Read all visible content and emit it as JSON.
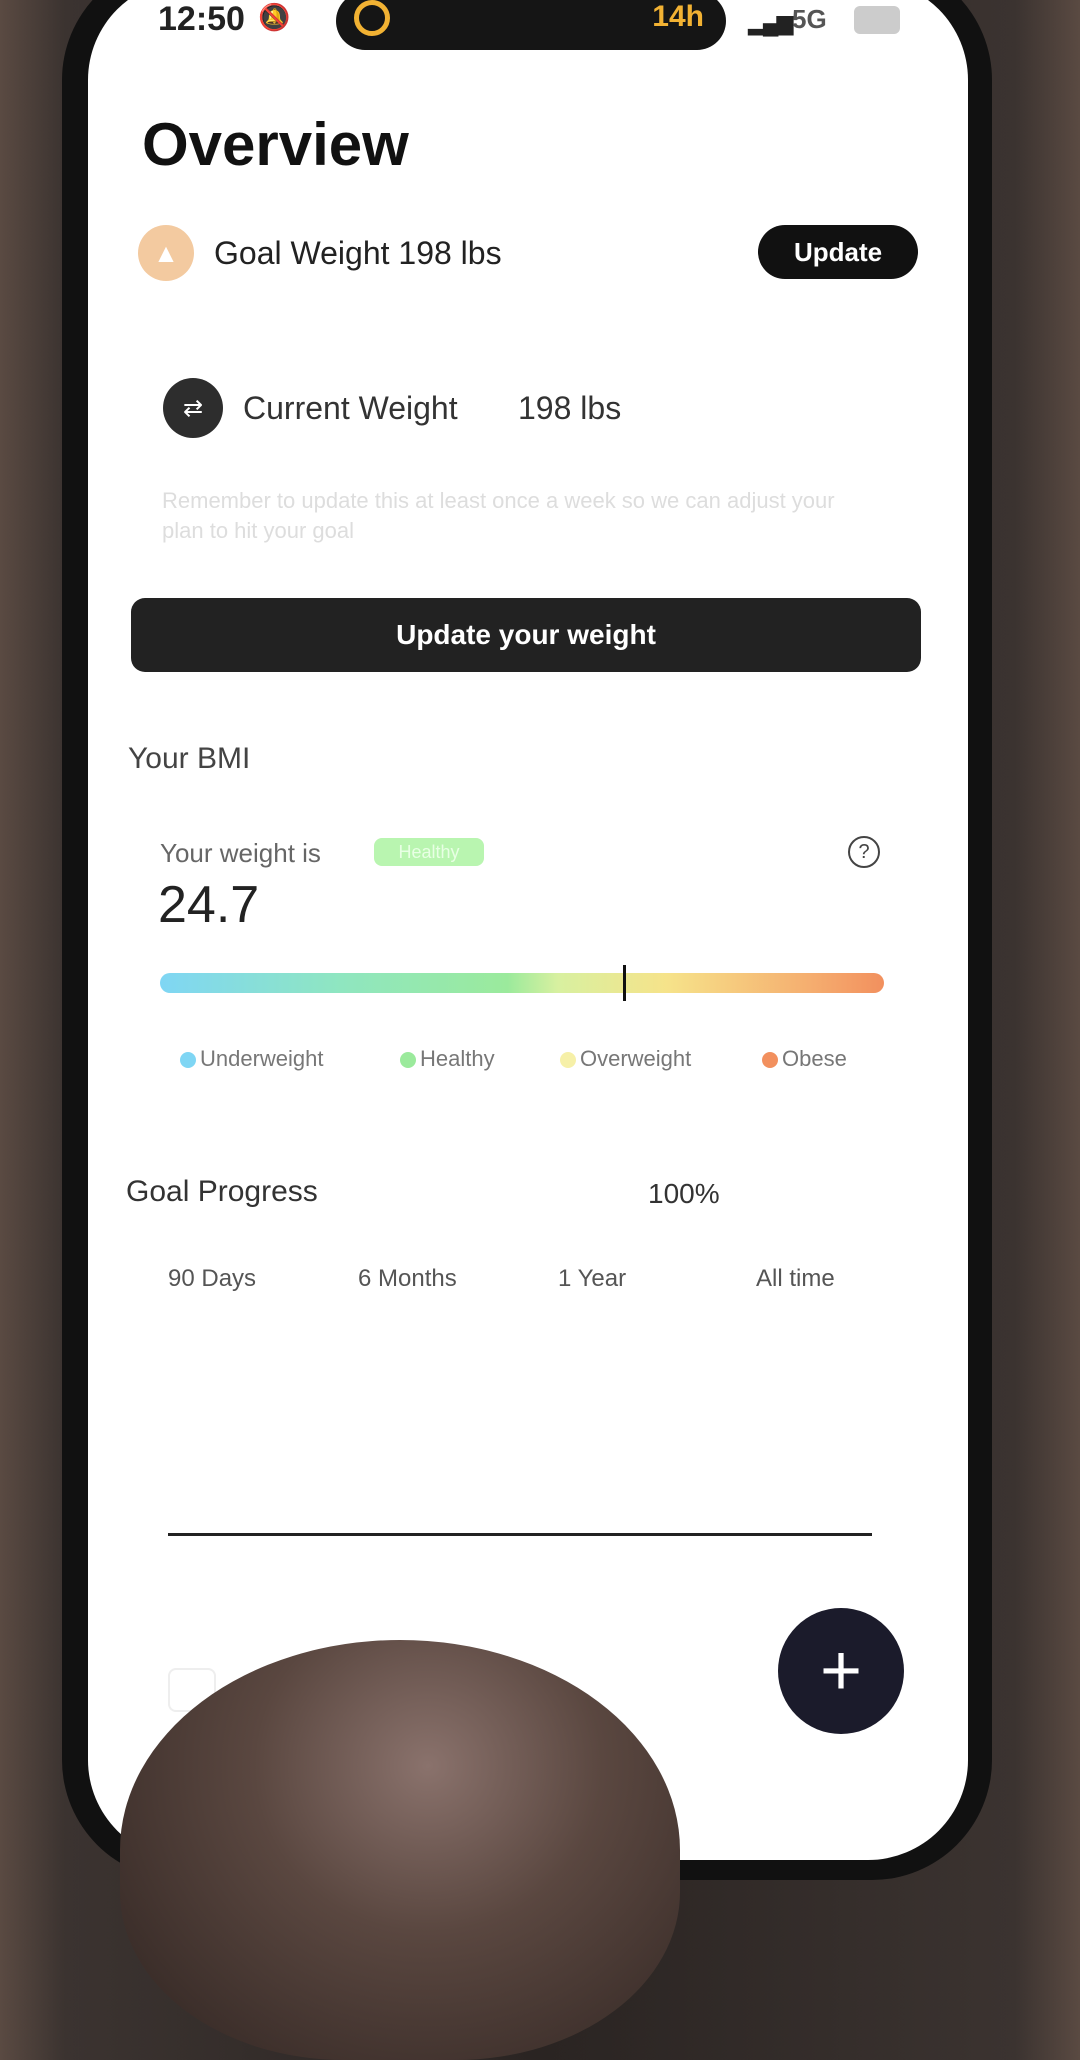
{
  "status_bar": {
    "time": "12:50",
    "timer": "14h",
    "network": "5G"
  },
  "page": {
    "title": "Overview"
  },
  "goal": {
    "label": "Goal Weight 198 lbs",
    "update_label": "Update",
    "icon": "trophy-icon"
  },
  "current": {
    "label": "Current Weight",
    "value": "198 lbs",
    "icon": "dumbbell-icon",
    "reminder": "Remember to update this at least once a week so we can adjust your plan to hit your goal"
  },
  "main_button": {
    "label": "Update your weight"
  },
  "bmi": {
    "heading": "Your BMI",
    "weight_is": "Your weight is",
    "status": "Healthy",
    "value": "24.7",
    "help": "?",
    "marker_fraction": 0.64,
    "legend": [
      {
        "label": "Underweight",
        "color": "#7fd6f4"
      },
      {
        "label": "Healthy",
        "color": "#9bea9c"
      },
      {
        "label": "Overweight",
        "color": "#f6f0a8"
      },
      {
        "label": "Obese",
        "color": "#f2905e"
      }
    ]
  },
  "goal_progress": {
    "label": "Goal Progress",
    "percent": "100%",
    "ranges": [
      "90 Days",
      "6 Months",
      "1 Year",
      "All time"
    ]
  },
  "fab": {
    "label": "+"
  }
}
